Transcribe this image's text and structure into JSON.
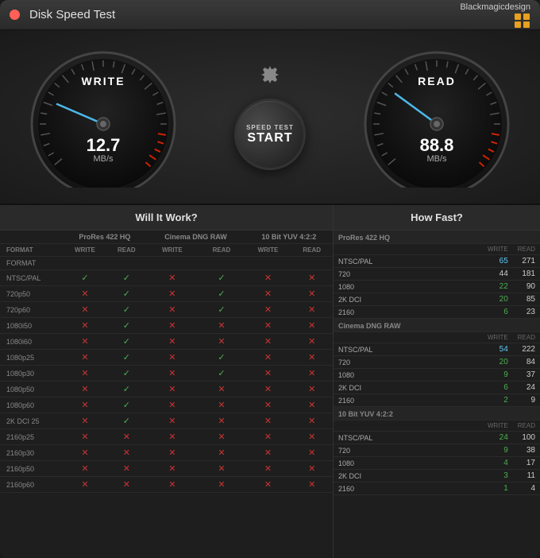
{
  "titlebar": {
    "title": "Disk Speed Test",
    "brand": "Blackmagicdesign",
    "close_label": "close"
  },
  "gauge_write": {
    "label": "WRITE",
    "value": "12.7",
    "unit": "MB/s"
  },
  "gauge_read": {
    "label": "READ",
    "value": "88.8",
    "unit": "MB/s"
  },
  "start_button": {
    "small": "SPEED TEST",
    "large": "START"
  },
  "will_it_work": {
    "header": "Will It Work?",
    "col_groups": [
      "ProRes 422 HQ",
      "Cinema DNG RAW",
      "10 Bit YUV 4:2:2"
    ],
    "sub_headers": [
      "WRITE",
      "READ"
    ],
    "rows": [
      {
        "format": "FORMAT",
        "header": true
      },
      {
        "format": "NTSC/PAL",
        "p422hq_w": true,
        "p422hq_r": true,
        "cdng_w": false,
        "cdng_r": true,
        "yuv_w": false,
        "yuv_r": false
      },
      {
        "format": "720p50",
        "p422hq_w": false,
        "p422hq_r": true,
        "cdng_w": false,
        "cdng_r": true,
        "yuv_w": false,
        "yuv_r": false
      },
      {
        "format": "720p60",
        "p422hq_w": false,
        "p422hq_r": true,
        "cdng_w": false,
        "cdng_r": true,
        "yuv_w": false,
        "yuv_r": false
      },
      {
        "format": "1080i50",
        "p422hq_w": false,
        "p422hq_r": true,
        "cdng_w": false,
        "cdng_r": false,
        "yuv_w": false,
        "yuv_r": false
      },
      {
        "format": "1080i60",
        "p422hq_w": false,
        "p422hq_r": true,
        "cdng_w": false,
        "cdng_r": false,
        "yuv_w": false,
        "yuv_r": false
      },
      {
        "format": "1080p25",
        "p422hq_w": false,
        "p422hq_r": true,
        "cdng_w": false,
        "cdng_r": true,
        "yuv_w": false,
        "yuv_r": false
      },
      {
        "format": "1080p30",
        "p422hq_w": false,
        "p422hq_r": true,
        "cdng_w": false,
        "cdng_r": true,
        "yuv_w": false,
        "yuv_r": false
      },
      {
        "format": "1080p50",
        "p422hq_w": false,
        "p422hq_r": true,
        "cdng_w": false,
        "cdng_r": false,
        "yuv_w": false,
        "yuv_r": false
      },
      {
        "format": "1080p60",
        "p422hq_w": false,
        "p422hq_r": true,
        "cdng_w": false,
        "cdng_r": false,
        "yuv_w": false,
        "yuv_r": false
      },
      {
        "format": "2K DCI 25",
        "p422hq_w": false,
        "p422hq_r": true,
        "cdng_w": false,
        "cdng_r": false,
        "yuv_w": false,
        "yuv_r": false
      },
      {
        "format": "2160p25",
        "p422hq_w": false,
        "p422hq_r": false,
        "cdng_w": false,
        "cdng_r": false,
        "yuv_w": false,
        "yuv_r": false
      },
      {
        "format": "2160p30",
        "p422hq_w": false,
        "p422hq_r": false,
        "cdng_w": false,
        "cdng_r": false,
        "yuv_w": false,
        "yuv_r": false
      },
      {
        "format": "2160p50",
        "p422hq_w": false,
        "p422hq_r": false,
        "cdng_w": false,
        "cdng_r": false,
        "yuv_w": false,
        "yuv_r": false
      },
      {
        "format": "2160p60",
        "p422hq_w": false,
        "p422hq_r": false,
        "cdng_w": false,
        "cdng_r": false,
        "yuv_w": false,
        "yuv_r": false
      }
    ]
  },
  "how_fast": {
    "header": "How Fast?",
    "groups": [
      {
        "name": "ProRes 422 HQ",
        "rows": [
          {
            "format": "NTSC/PAL",
            "write": 65,
            "write_color": "blue",
            "read": 271,
            "read_color": "green"
          },
          {
            "format": "720",
            "write": 44,
            "write_color": "white",
            "read": 181,
            "read_color": "green"
          },
          {
            "format": "1080",
            "write": 22,
            "write_color": "green",
            "read": 90,
            "read_color": "green"
          },
          {
            "format": "2K DCI",
            "write": 20,
            "write_color": "green",
            "read": 85,
            "read_color": "green"
          },
          {
            "format": "2160",
            "write": 6,
            "write_color": "green",
            "read": 23,
            "read_color": "green"
          }
        ]
      },
      {
        "name": "Cinema DNG RAW",
        "rows": [
          {
            "format": "NTSC/PAL",
            "write": 54,
            "write_color": "blue",
            "read": 222,
            "read_color": "green"
          },
          {
            "format": "720",
            "write": 20,
            "write_color": "green",
            "read": 84,
            "read_color": "green"
          },
          {
            "format": "1080",
            "write": 9,
            "write_color": "green",
            "read": 37,
            "read_color": "green"
          },
          {
            "format": "2K DCI",
            "write": 6,
            "write_color": "green",
            "read": 24,
            "read_color": "green"
          },
          {
            "format": "2160",
            "write": 2,
            "write_color": "green",
            "read": 9,
            "read_color": "green"
          }
        ]
      },
      {
        "name": "10 Bit YUV 4:2:2",
        "rows": [
          {
            "format": "NTSC/PAL",
            "write": 24,
            "write_color": "green",
            "read": 100,
            "read_color": "green"
          },
          {
            "format": "720",
            "write": 9,
            "write_color": "green",
            "read": 38,
            "read_color": "green"
          },
          {
            "format": "1080",
            "write": 4,
            "write_color": "green",
            "read": 17,
            "read_color": "green"
          },
          {
            "format": "2K DCI",
            "write": 3,
            "write_color": "green",
            "read": 11,
            "read_color": "green"
          },
          {
            "format": "2160",
            "write": 1,
            "write_color": "green",
            "read": 4,
            "read_color": "green"
          }
        ]
      }
    ]
  }
}
